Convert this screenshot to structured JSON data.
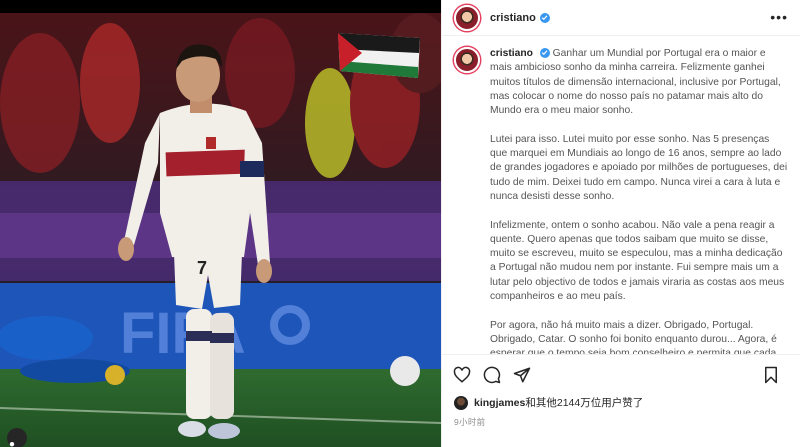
{
  "post": {
    "username": "cristiano",
    "verified": true,
    "caption_paragraphs": [
      "Ganhar um Mundial por Portugal era o maior e mais ambicioso sonho da minha carreira. Felizmente ganhei muitos títulos de dimensão internacional, inclusive por Portugal, mas colocar o nome do nosso país no patamar mais alto do Mundo era o meu maior sonho.",
      "Lutei para isso. Lutei muito por esse sonho. Nas 5 presenças que marquei em Mundiais ao longo de 16 anos, sempre ao lado de grandes jogadores e apoiado por milhões de portugueses, dei tudo de mim. Deixei tudo em campo. Nunca virei a cara à luta e nunca desisti desse sonho.",
      "Infelizmente, ontem o sonho acabou. Não vale a pena reagir a quente. Quero apenas que todos saibam que muito se disse, muito se escreveu, muito se especulou, mas a minha dedicação a Portugal não mudou nem por instante. Fui sempre mais um a lutar pelo objectivo de todos e jamais viraria as costas aos meus companheiros e ao meu país.",
      "Por agora, não há muito mais a dizer. Obrigado, Portugal. Obrigado, Catar. O sonho foi bonito enquanto durou... Agora, é esperar que o tempo seja bom conselheiro e permita que cada um tire as suas próprias conclusões."
    ],
    "likes_text_user": "kingjames",
    "likes_text_rest": "和其他2144万位用户赞了",
    "time_ago": "9小时前"
  },
  "photo": {
    "jersey_number": "7",
    "banner_text": "FIFA",
    "jersey_color": "#f2efe9",
    "accent_red": "#a3202c"
  },
  "icons": {
    "more": "more-options-icon",
    "like": "heart-icon",
    "comment": "comment-icon",
    "share": "share-icon",
    "save": "bookmark-icon",
    "tags": "user-tag-icon"
  }
}
